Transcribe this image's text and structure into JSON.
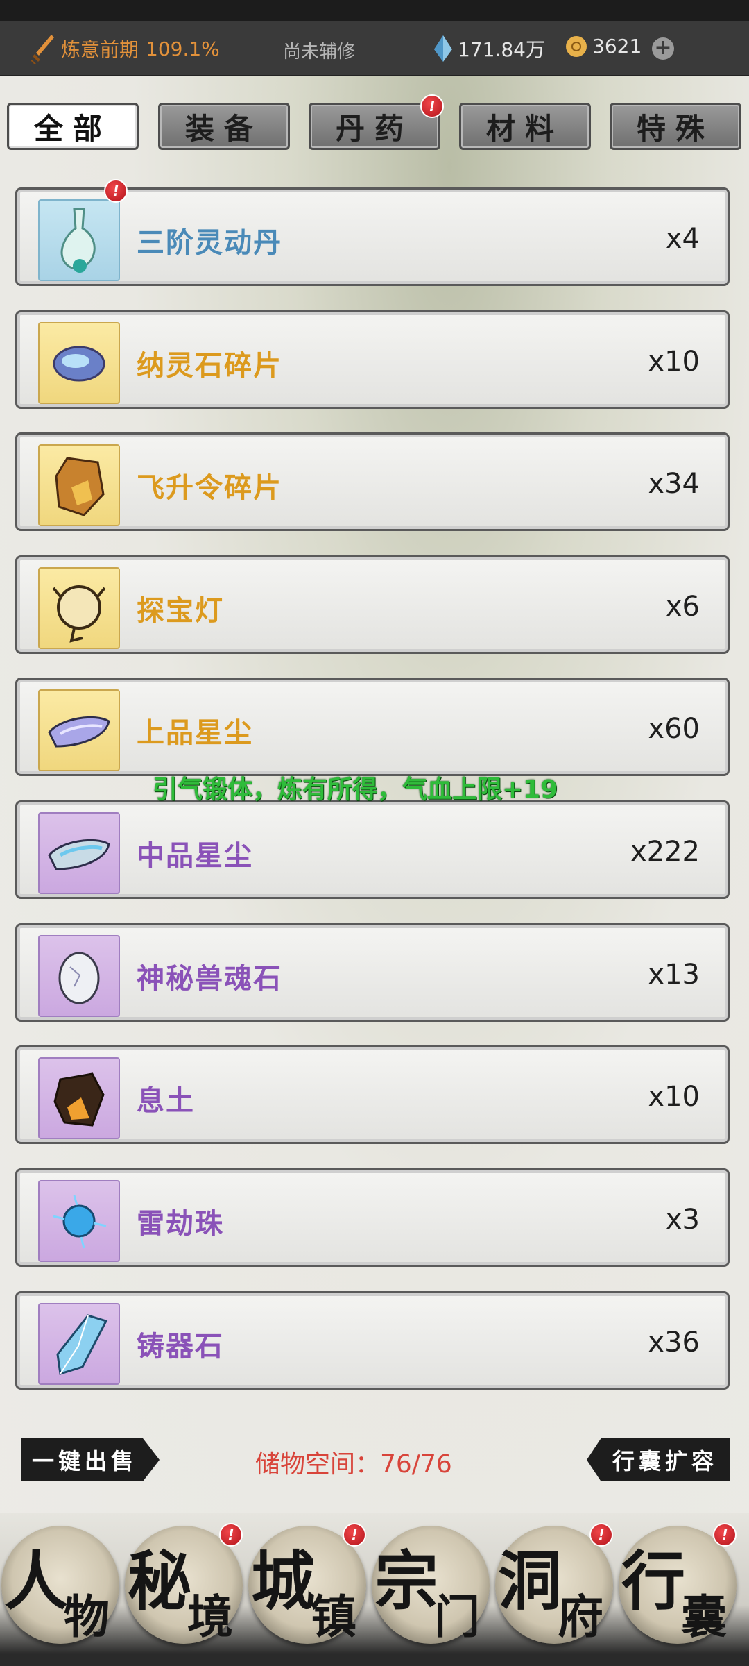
{
  "topbar": {
    "realm": "炼意前期",
    "realm_percent": "109.1%",
    "assist": "尚未辅修",
    "crystal": "171.84万",
    "coins": "3621",
    "plus": "+"
  },
  "tabs": [
    {
      "label": "全部",
      "active": true,
      "badge": false
    },
    {
      "label": "装备",
      "active": false,
      "badge": false
    },
    {
      "label": "丹药",
      "active": false,
      "badge": true
    },
    {
      "label": "材料",
      "active": false,
      "badge": false
    },
    {
      "label": "特殊",
      "active": false,
      "badge": false
    }
  ],
  "badge_mark": "!",
  "items": [
    {
      "name": "三阶灵动丹",
      "count": "x4",
      "rarity": "blue",
      "badge": true,
      "icon": "potion-flask-icon"
    },
    {
      "name": "纳灵石碎片",
      "count": "x10",
      "rarity": "gold",
      "badge": false,
      "icon": "spirit-stone-fragment-icon"
    },
    {
      "name": "飞升令碎片",
      "count": "x34",
      "rarity": "gold",
      "badge": false,
      "icon": "ascension-token-fragment-icon"
    },
    {
      "name": "探宝灯",
      "count": "x6",
      "rarity": "gold",
      "badge": false,
      "icon": "treasure-lamp-icon"
    },
    {
      "name": "上品星尘",
      "count": "x60",
      "rarity": "gold",
      "badge": false,
      "icon": "stardust-icon"
    },
    {
      "name": "中品星尘",
      "count": "x222",
      "rarity": "purple",
      "badge": false,
      "icon": "stardust-icon"
    },
    {
      "name": "神秘兽魂石",
      "count": "x13",
      "rarity": "purple",
      "badge": false,
      "icon": "beast-soul-stone-icon"
    },
    {
      "name": "息土",
      "count": "x10",
      "rarity": "purple",
      "badge": false,
      "icon": "breathing-soil-icon"
    },
    {
      "name": "雷劫珠",
      "count": "x3",
      "rarity": "purple",
      "badge": false,
      "icon": "thunder-pearl-icon"
    },
    {
      "name": "铸器石",
      "count": "x36",
      "rarity": "purple",
      "badge": false,
      "icon": "forging-crystal-icon"
    }
  ],
  "floating_message": "引气锻体，炼有所得，气血上限+19",
  "actions": {
    "sell_all": "一键出售",
    "storage_label": "储物空间：76/76",
    "expand": "行囊扩容"
  },
  "nav": [
    {
      "t1": "人",
      "t2": "物",
      "badge": false
    },
    {
      "t1": "秘",
      "t2": "境",
      "badge": true
    },
    {
      "t1": "城",
      "t2": "镇",
      "badge": true
    },
    {
      "t1": "宗",
      "t2": "门",
      "badge": false
    },
    {
      "t1": "洞",
      "t2": "府",
      "badge": true
    },
    {
      "t1": "行",
      "t2": "囊",
      "badge": true
    }
  ],
  "colors": {
    "rarity_blue": "#4a8ab8",
    "rarity_gold": "#dc9a1e",
    "rarity_purple": "#8a52b8",
    "storage_red": "#d8443a",
    "message_green": "#2fbc3a"
  }
}
